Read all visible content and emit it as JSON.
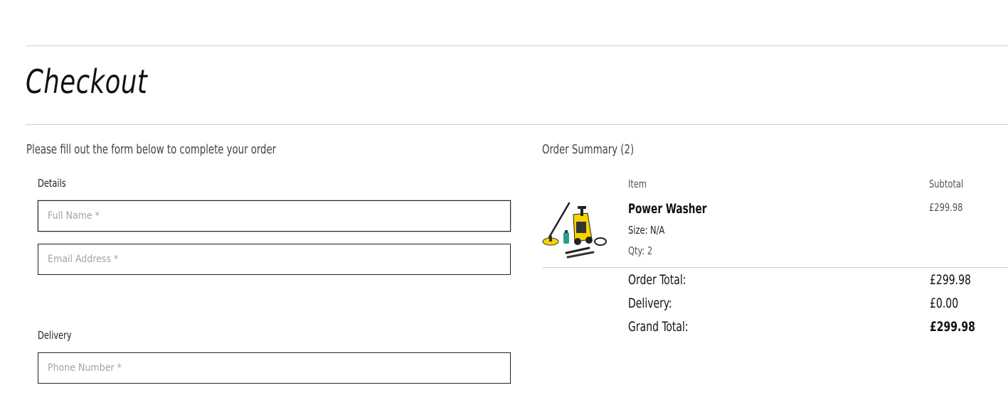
{
  "page": {
    "title": "Checkout",
    "intro": "Please fill out the form below to complete your order"
  },
  "form": {
    "details_label": "Details",
    "full_name": {
      "value": "",
      "placeholder": "Full Name *"
    },
    "email": {
      "value": "",
      "placeholder": "Email Address *"
    },
    "delivery_label": "Delivery",
    "phone": {
      "value": "",
      "placeholder": "Phone Number *"
    }
  },
  "summary": {
    "title": "Order Summary (2)",
    "col_item": "Item",
    "col_subtotal": "Subtotal",
    "items": [
      {
        "name": "Power Washer",
        "size": "Size: N/A",
        "qty": "Qty: 2",
        "subtotal": "£299.98",
        "image_icon": "power-washer-image"
      }
    ],
    "order_total_label": "Order Total:",
    "order_total": "£299.98",
    "delivery_label": "Delivery:",
    "delivery": "£0.00",
    "grand_total_label": "Grand Total:",
    "grand_total": "£299.98"
  },
  "colors": {
    "border": "#222222",
    "divider": "#cfcfcf",
    "product_accent": "#f5d500"
  }
}
